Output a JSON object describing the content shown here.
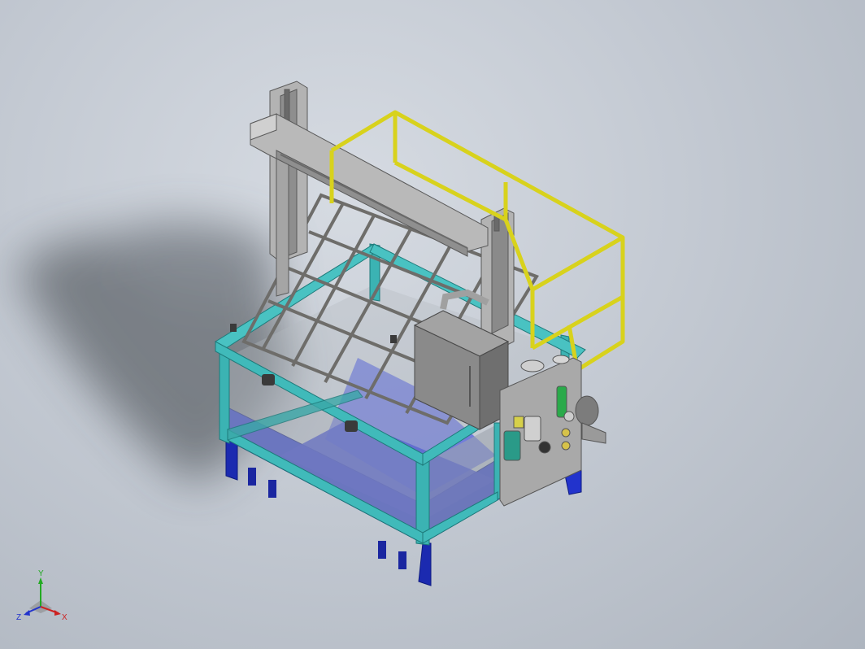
{
  "viewport": {
    "background_top": "#d6dbe2",
    "background_bottom": "#aeb5bf"
  },
  "model": {
    "base_color": "#2233cc",
    "frame_color": "#33aaaa",
    "rail_color": "#e0e020",
    "steel_color": "#9a9a9a",
    "cabinet_color": "#8c8c8c",
    "fitting_color": "#2aaa4a"
  },
  "triad": {
    "x_label": "X",
    "y_label": "Y",
    "z_label": "Z",
    "x_color": "#cc2222",
    "y_color": "#22aa22",
    "z_color": "#2233cc"
  }
}
